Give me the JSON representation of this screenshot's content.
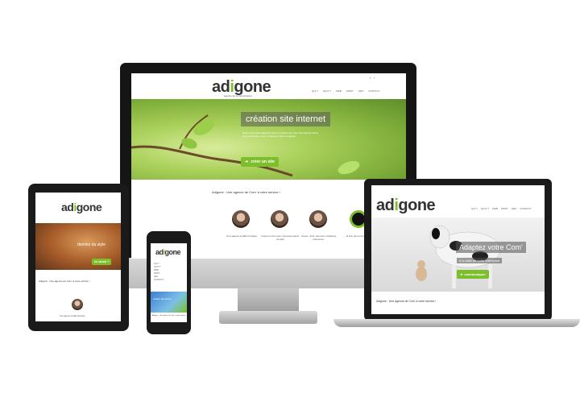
{
  "brand": {
    "logo_prefix": "ad",
    "logo_dot": "i",
    "logo_suffix": "gone",
    "tagline": "agence de communication",
    "accent_color": "#7cbf2a"
  },
  "desktop": {
    "nav": [
      "QUI ?",
      "QUOI ?",
      "WEB",
      "PRINT",
      "SEO",
      "CONTACT"
    ],
    "social_icons": [
      "facebook-icon",
      "twitter-icon"
    ],
    "hero_title": "création site internet",
    "hero_text": "Nous vous accompagnons dans la création de votre site internet vitrine ou e-commerce, avec un design unique et adapté.",
    "hero_button": "créer un site",
    "section_title": "Adigone : Une agence de Com' à votre service !",
    "team": [
      {
        "caption": "Une agence à taille humaine"
      },
      {
        "caption": "Internet c'est nous. Nouveau acteur du web"
      },
      {
        "caption": "Crées : droit, donnons confiance, entrevient..."
      },
      {
        "caption": "... la bon prix pour le site web"
      }
    ]
  },
  "laptop": {
    "nav": [
      "QUI ?",
      "QUOI ?",
      "WEB",
      "PRINT",
      "SEO",
      "CONTACT"
    ],
    "hero_title": "Adaptez votre Com'",
    "hero_sub": "à la taille de votre entreprise",
    "hero_button": "communiquer",
    "section_title": "Adigone : Une agence de Com' à votre service !"
  },
  "tablet": {
    "hero_text": "donnez du style",
    "hero_button": "en savoir +",
    "section_title": "Adigone : Une agence de Com' à votre service !",
    "caption": "Une agence à taille humaine"
  },
  "phone": {
    "nav": [
      "QUI ?",
      "QUOI ?",
      "WEB",
      "PRINT",
      "SEO",
      "CONTACT"
    ],
    "hero_text": "création site internet",
    "section_title": "Adigone : Une agence de Com' à votre service !"
  }
}
